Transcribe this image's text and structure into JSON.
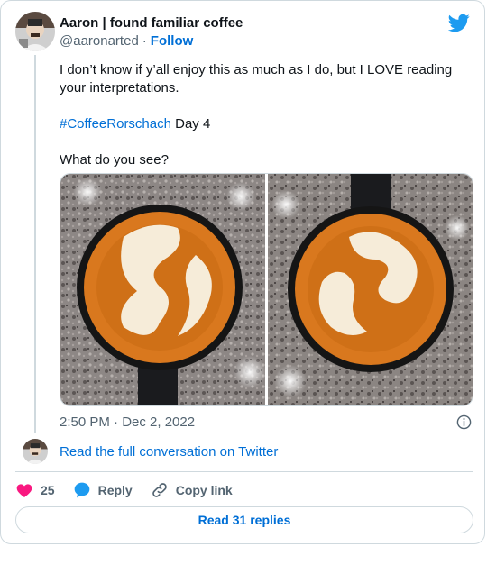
{
  "author": {
    "name": "Aaron | found familiar coffee",
    "handle": "@aaronarted",
    "separator": "·",
    "follow_label": "Follow"
  },
  "tweet": {
    "line1": "I don’t know if y’all enjoy this as much as I do, but I LOVE reading your interpretations.",
    "hashtag": "#CoffeeRorschach",
    "hashtag_suffix": " Day 4",
    "question": "What do you see?"
  },
  "timestamp": "2:50 PM · Dec 2, 2022",
  "full_conversation_label": "Read the full conversation on Twitter",
  "actions": {
    "like_count": "25",
    "reply_label": "Reply",
    "copy_link_label": "Copy link"
  },
  "read_replies_label": "Read 31 replies",
  "colors": {
    "accent": "#006fd6",
    "twitter_blue": "#1d9bf0",
    "like_pink": "#f91880",
    "muted": "#536471",
    "border": "#cfd9de"
  },
  "icons": [
    "twitter-bird-icon",
    "info-icon",
    "heart-icon",
    "reply-bubble-icon",
    "link-icon"
  ],
  "media": {
    "images": [
      "coffee-latte-art-left",
      "coffee-latte-art-right"
    ]
  }
}
